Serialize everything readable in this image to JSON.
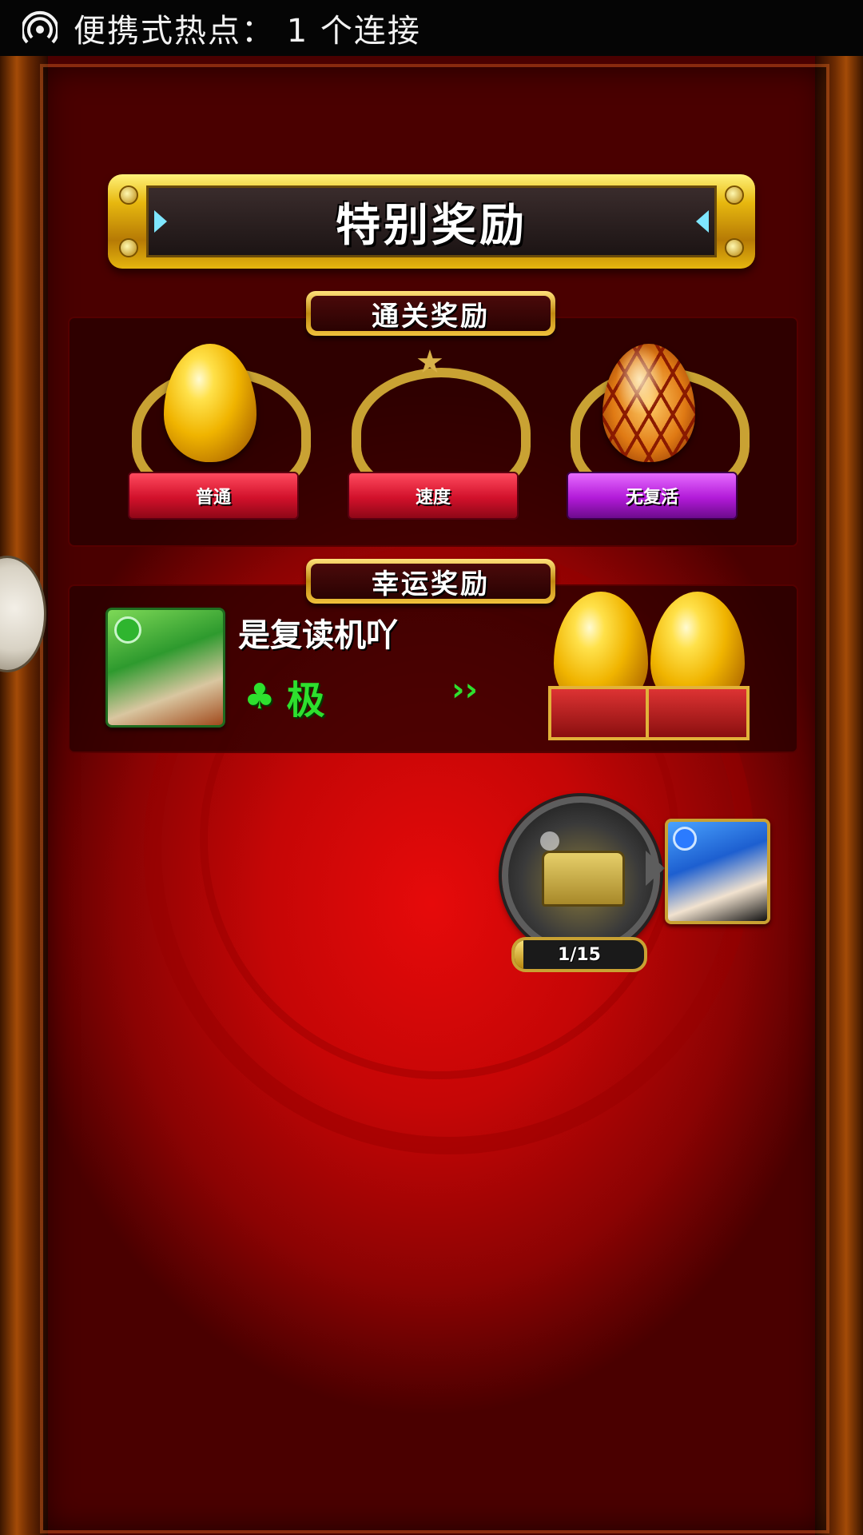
{
  "status_bar": {
    "icon": "hotspot-icon",
    "text": "便携式热点： 1 个连接"
  },
  "title_banner": {
    "title": "特别奖励"
  },
  "clear_rewards": {
    "label": "通关奖励",
    "medals": [
      {
        "label": "普通",
        "has_egg": true,
        "egg_type": "gold"
      },
      {
        "label": "速度",
        "has_egg": false
      },
      {
        "label": "无复活",
        "has_egg": true,
        "egg_type": "hex"
      }
    ]
  },
  "lucky_rewards": {
    "label": "幸运奖励",
    "player_name": "是复读机吖",
    "luck_icon": "clover-icon",
    "luck_rank": "极",
    "chevrons": "››",
    "egg_count": 2
  },
  "treasure": {
    "icon": "treasure-chest-icon",
    "progress_text": "1/15",
    "progress_fraction": 0.0667
  },
  "colors": {
    "background_red": "#c50606",
    "gold": "#e7b80f",
    "ribbon_red": "#d2112b",
    "ribbon_purple": "#b21ad8",
    "luck_green": "#2ee02e"
  }
}
